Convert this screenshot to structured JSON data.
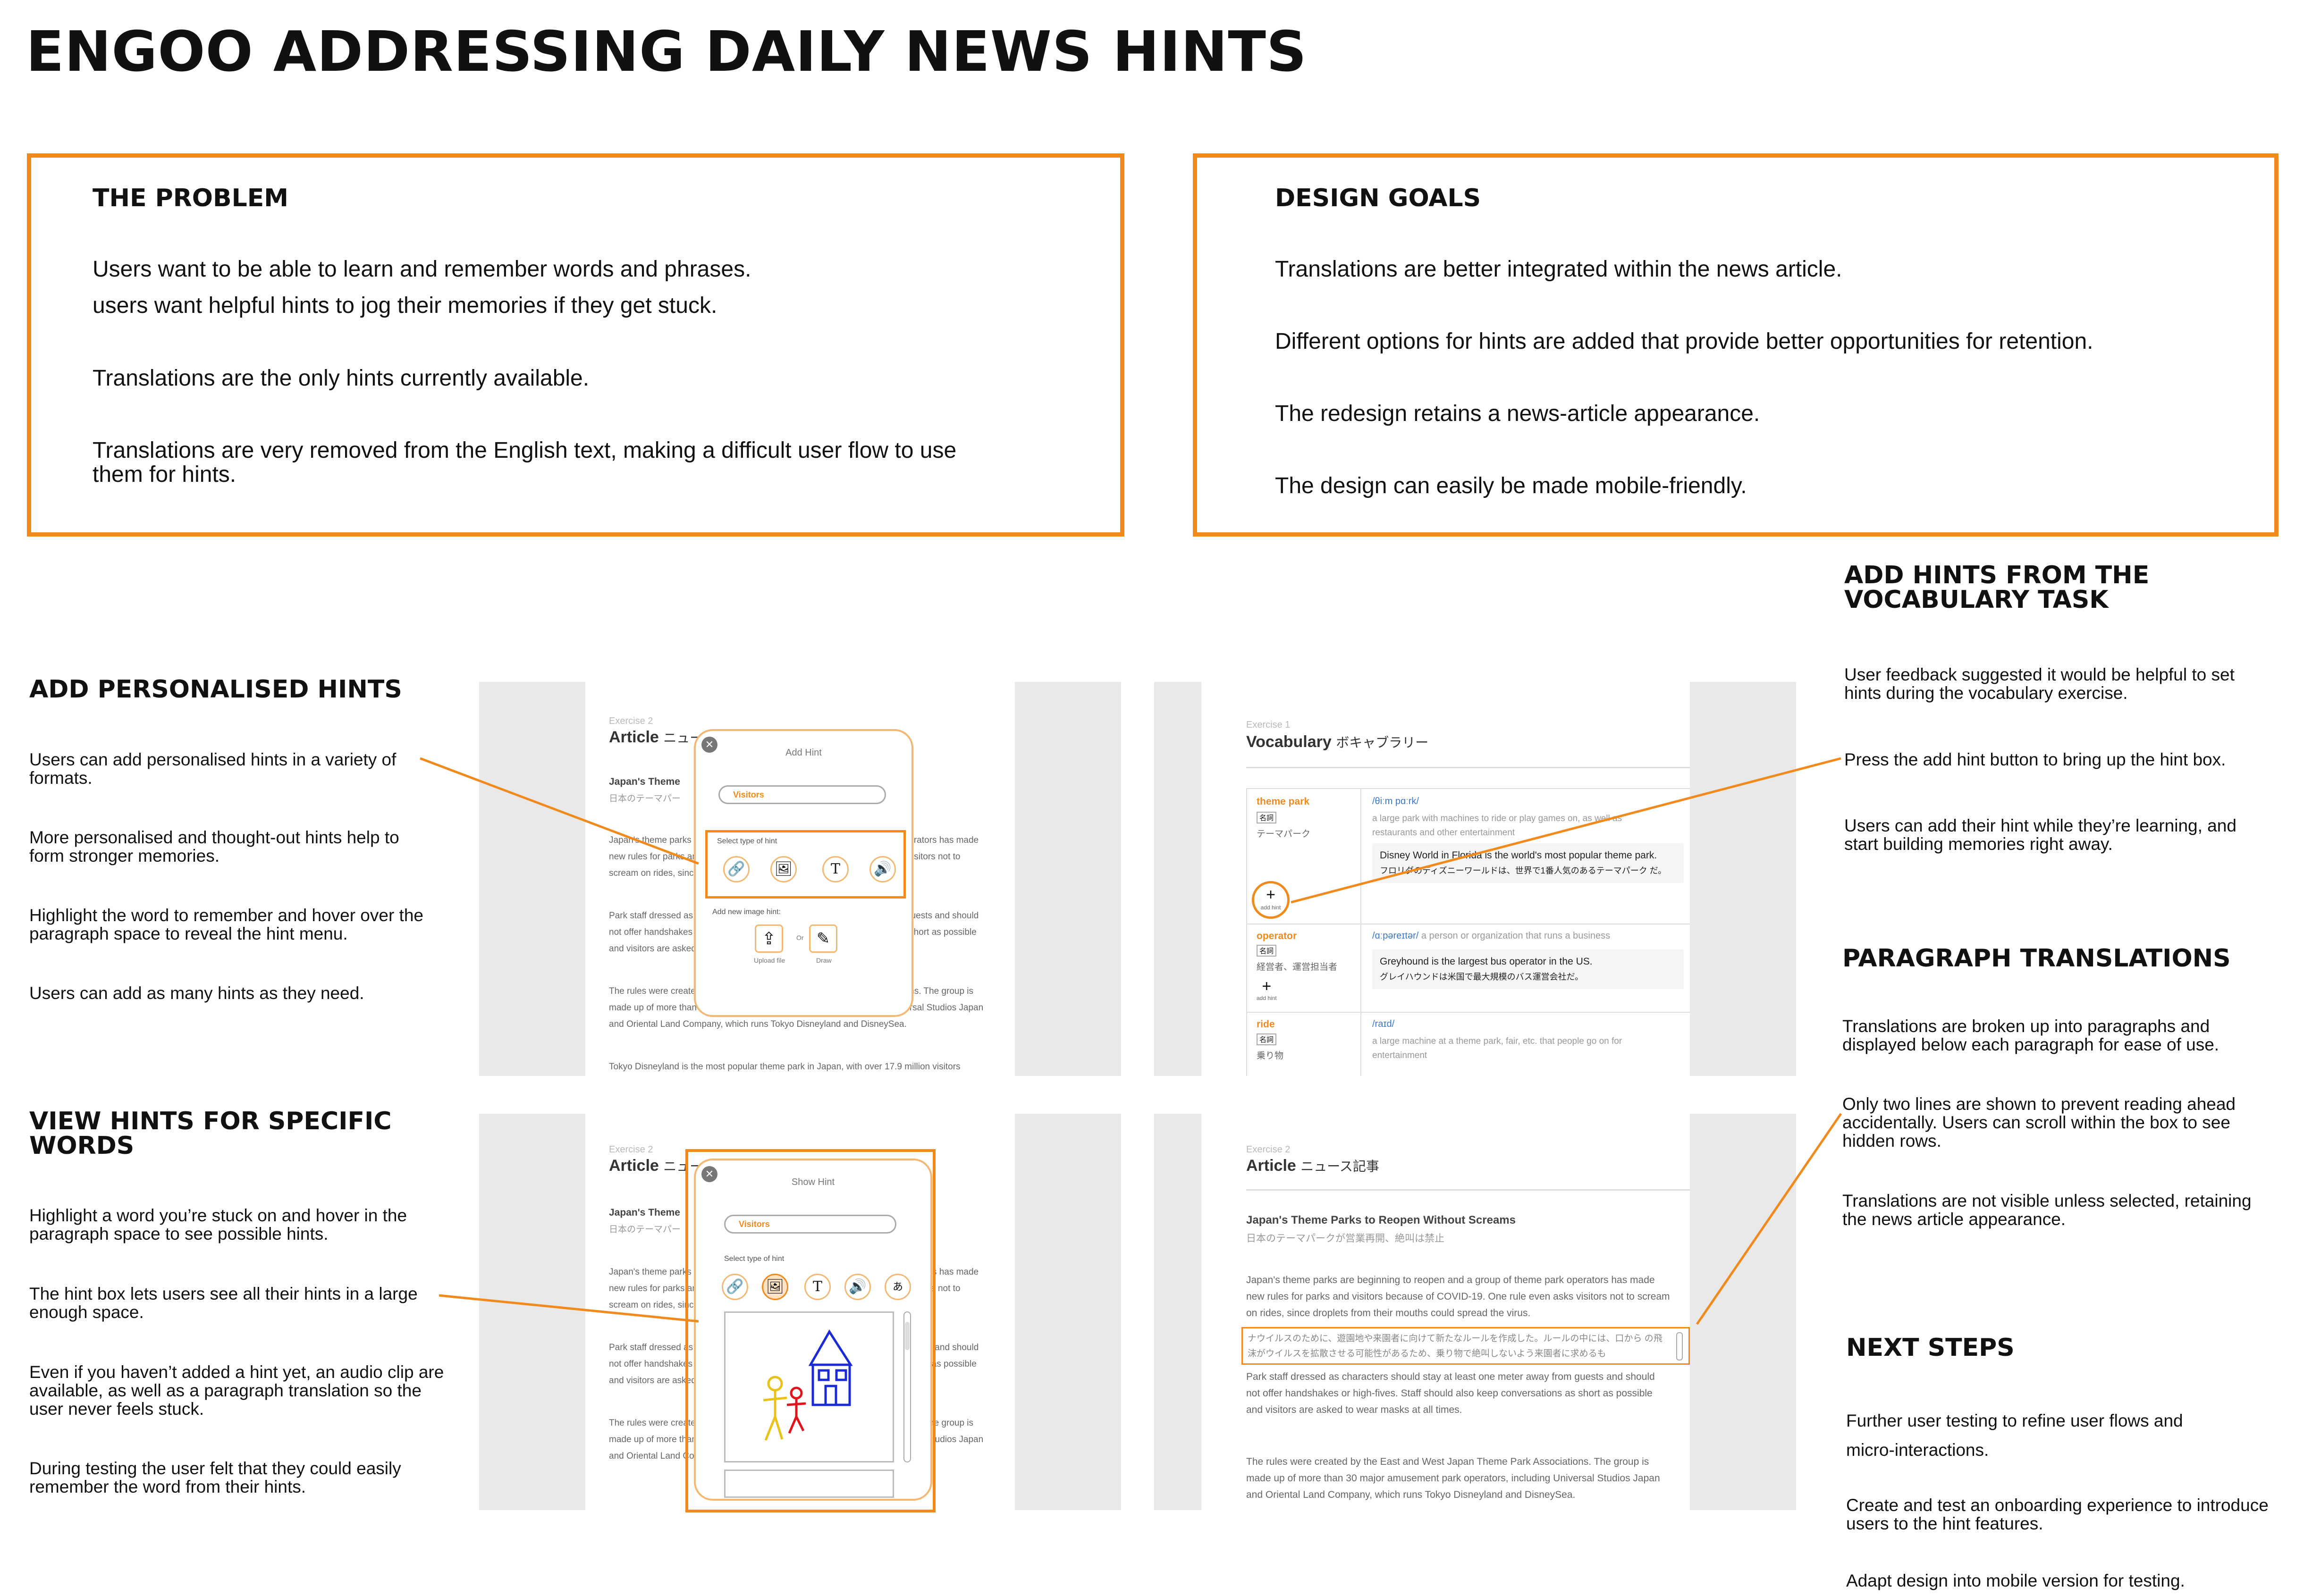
{
  "title": "ENGOO ADDRESSING DAILY NEWS HINTS",
  "problem": {
    "heading": "THE PROBLEM",
    "lines": [
      "Users want to be able to learn and remember words and phrases.",
      "users want helpful hints to jog their memories if they get stuck.",
      "Translations are the only hints currently available.",
      "Translations are very removed from the English text, making a difficult user flow to use",
      "them for hints."
    ]
  },
  "goals": {
    "heading": "DESIGN GOALS",
    "lines": [
      "Translations are better integrated within the news article.",
      "Different options for hints are added that provide better opportunities for retention.",
      "The redesign retains a news-article appearance.",
      "The design can easily be made mobile-friendly."
    ]
  },
  "add_personalised": {
    "heading": "ADD PERSONALISED HINTS",
    "paras": [
      "Users can add personalised hints in a variety of formats.",
      "More personalised and thought-out hints help to form stronger memories.",
      "Highlight the word to remember and hover over the paragraph space to reveal the hint menu.",
      "Users can add as many hints as they need."
    ]
  },
  "view_hints": {
    "heading_1": "VIEW HINTS FOR SPECIFIC",
    "heading_2": "WORDS",
    "paras": [
      "Highlight a word you’re stuck on and hover in the paragraph space to see possible hints.",
      "The hint box lets users see all their hints in a large enough space.",
      "Even if you haven’t added a hint yet, an audio clip are available, as well as a paragraph translation so the user never feels stuck.",
      "During testing the user felt that they could easily remember the word from their hints."
    ]
  },
  "vocab_hints": {
    "heading_1": "ADD HINTS FROM THE",
    "heading_2": "VOCABULARY TASK",
    "paras": [
      "User feedback suggested it would be helpful to set hints during the vocabulary exercise.",
      "Press the add hint button to bring up the hint box.",
      "Users can add their hint while they’re learning, and start building memories right away."
    ]
  },
  "para_trans": {
    "heading": "PARAGRAPH TRANSLATIONS",
    "paras": [
      "Translations are broken up into paragraphs and displayed below each paragraph for ease of use.",
      "Only two lines are shown to prevent reading ahead accidentally. Users can scroll within the box to see hidden rows.",
      "Translations are not visible unless selected, retaining the news article appearance."
    ]
  },
  "next_steps": {
    "heading": "NEXT STEPS",
    "paras": [
      "Further user testing to refine user flows and micro-interactions.",
      "Create and test an onboarding experience to introduce users to the hint features.",
      "Adapt design into mobile version for testing."
    ]
  },
  "mock": {
    "ex2": "Exercise 2",
    "article": "Article",
    "article_jp": "ニュース記事",
    "ex1": "Exercise 1",
    "vocab": "Vocabulary",
    "vocab_jp": "ボキャブラリー",
    "story_title": "Japan's Theme Parks to Reopen Without Screams",
    "story_jp": "日本のテーマパークが営業再開、絶叫は禁止",
    "story_title_short": "Japan's Theme",
    "story_jp_short": "日本のテーマパー",
    "p1": "Japan's theme parks are beginning to reopen and a group of theme park operators has made new rules for parks and visitors because of COVID-19. One rule even asks visitors not to scream on rides, since droplets from their mouths could spread the virus.",
    "trans": "ナウイルスのために、遊園地や来園者に向けて新たなルールを作成した。ルールの中には、口から の飛沫がウイルスを拡散させる可能性があるため、乗り物で絶叫しないよう来園者に求めるも",
    "p2": "Park staff dressed as characters should stay at least one meter away from guests and should not offer handshakes or high-fives. Staff should also keep conversations as short as possible and visitors are asked to wear masks at all times.",
    "p3": "The rules were created by the East and West Japan Theme Park Associations. The group is made up of more than 30 major amusement park operators, including Universal Studios Japan and Oriental Land Company, which runs Tokyo Disneyland and DisneySea.",
    "p4": "Tokyo Disneyland is the most popular theme park in Japan, with over 17.9 million visitors",
    "add_hint": "Add Hint",
    "show_hint": "Show Hint",
    "visitors": "Visitors",
    "select_type": "Select type of hint",
    "add_image": "Add new image hint:",
    "upload": "Upload file",
    "or": "Or",
    "draw": "Draw",
    "v1_word": "theme park",
    "v1_pos": "名詞",
    "v1_jp": "テーマパーク",
    "v1_ipa": "/θiːm pɑːrk/",
    "v1_def": "a large park with machines to ride or play games on, as well as restaurants and other entertainment",
    "v1_ex": "Disney World in Florida is the world's most popular theme park.",
    "v1_exjp": "フロリダのディズニーワールドは、世界で1番人気のあるテーマパーク だ。",
    "add_hint_small": "add hint",
    "v2_word": "operator",
    "v2_pos": "名詞",
    "v2_jp": "経営者、運営担当者",
    "v2_ipa": "/ɑːpəreɪtər/",
    "v2_def": "a person or organization that runs a business",
    "v2_ex": "Greyhound is the largest bus operator in the US.",
    "v2_exjp": "グレイハウンドは米国で最大規模のバス運営会社だ。",
    "v3_word": "ride",
    "v3_pos": "名詞",
    "v3_jp": "乗り物",
    "v3_ipa": "/raɪd/",
    "v3_def": "a large machine at a theme park, fair, etc. that people go on for entertainment"
  },
  "colors": {
    "accent": "#f08a1c"
  },
  "icons": [
    "link-icon",
    "image-icon",
    "text-icon",
    "audio-icon",
    "translate-icon",
    "close-icon",
    "upload-icon",
    "pencil-icon",
    "plus-icon"
  ]
}
